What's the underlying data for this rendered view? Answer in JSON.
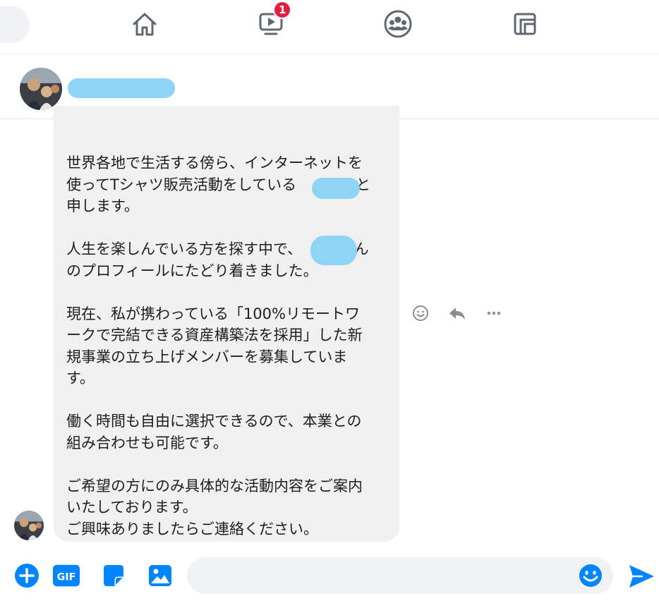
{
  "nav": {
    "items": [
      {
        "id": "home",
        "icon": "home-icon"
      },
      {
        "id": "watch",
        "icon": "video-play-icon",
        "badge": "1"
      },
      {
        "id": "groups",
        "icon": "groups-icon"
      },
      {
        "id": "gaming",
        "icon": "gaming-icon"
      }
    ]
  },
  "chat": {
    "contact_name": "-"
  },
  "message": {
    "text": "世界各地で生活する傍ら、インターネットを\n使ってTシャツ販売活動をしている　　　　と\n申します。\n\n人生を楽しんでいる方を探す中で、　　　さん\nのプロフィールにたどり着きました。\n\n現在、私が携わっている「100%リモートワ\nークで完結できる資産構築法を採用」した新\n規事業の立ち上げメンバーを募集していま\nす。\n\n働く時間も自由に選択できるので、本業との\n組み合わせも可能です。\n\nご希望の方にのみ具体的な活動内容をご案内\nいたしております。\nご興味ありましたらご連絡ください。",
    "actions": [
      "react-icon",
      "reply-icon",
      "more-icon"
    ]
  },
  "composer": {
    "buttons": [
      "add-icon",
      "gif-icon",
      "sticker-icon",
      "image-icon"
    ],
    "gif_label": "GIF",
    "input_value": "",
    "input_placeholder": ""
  },
  "colors": {
    "accent": "#0084ff",
    "badge": "#e41e3f",
    "bubble": "#f0f0f0",
    "redaction": "#8fd3f5",
    "nav_icon": "#606770"
  }
}
